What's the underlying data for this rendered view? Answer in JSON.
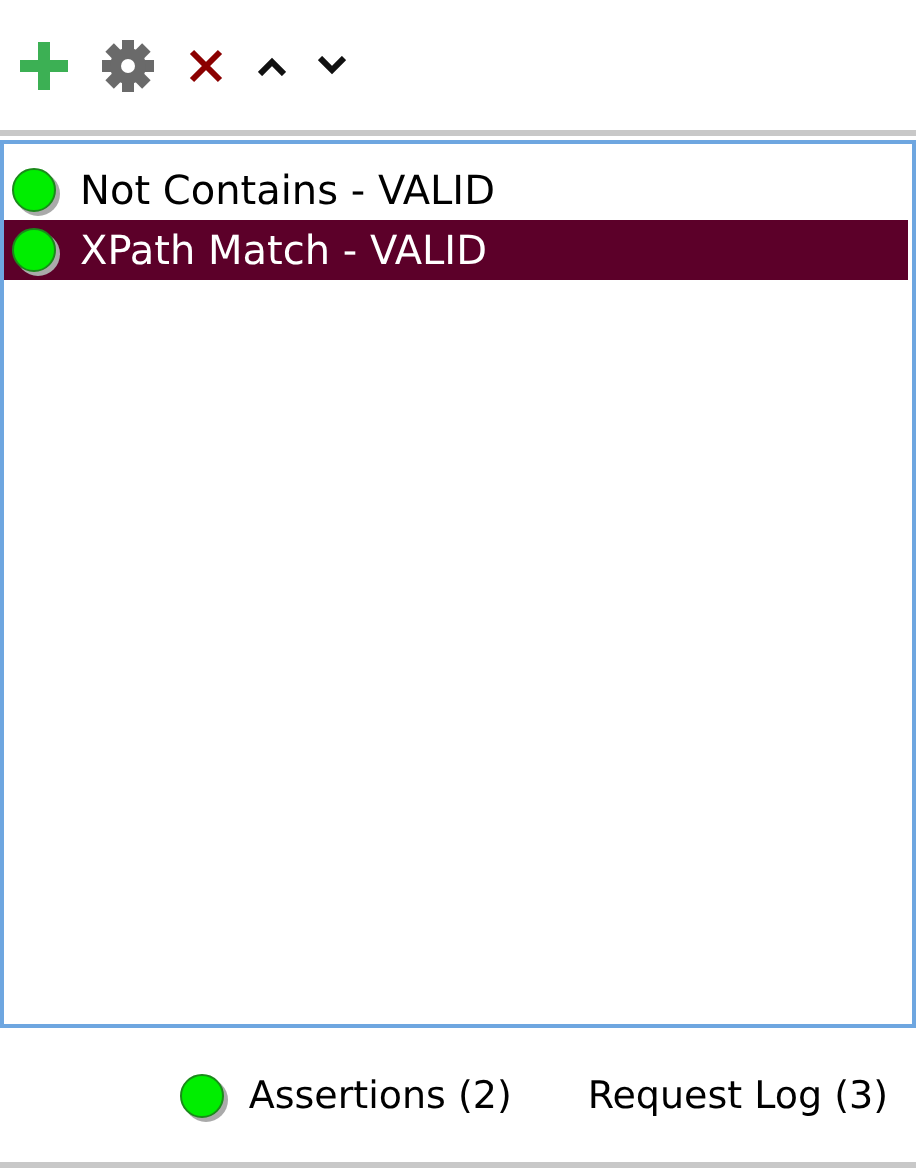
{
  "toolbar": {
    "buttons": [
      {
        "kind": "add"
      },
      {
        "kind": "configure"
      },
      {
        "kind": "remove"
      },
      {
        "kind": "up"
      },
      {
        "kind": "down"
      }
    ]
  },
  "assertions": [
    {
      "label": "Not Contains - VALID",
      "color": "#00ee00",
      "selected": false
    },
    {
      "label": "XPath Match - VALID",
      "color": "#00ee00",
      "selected": true
    }
  ],
  "tabs": [
    {
      "label": "Assertions (2)",
      "color": "#00ee00"
    },
    {
      "label": "Request Log (3)"
    }
  ]
}
